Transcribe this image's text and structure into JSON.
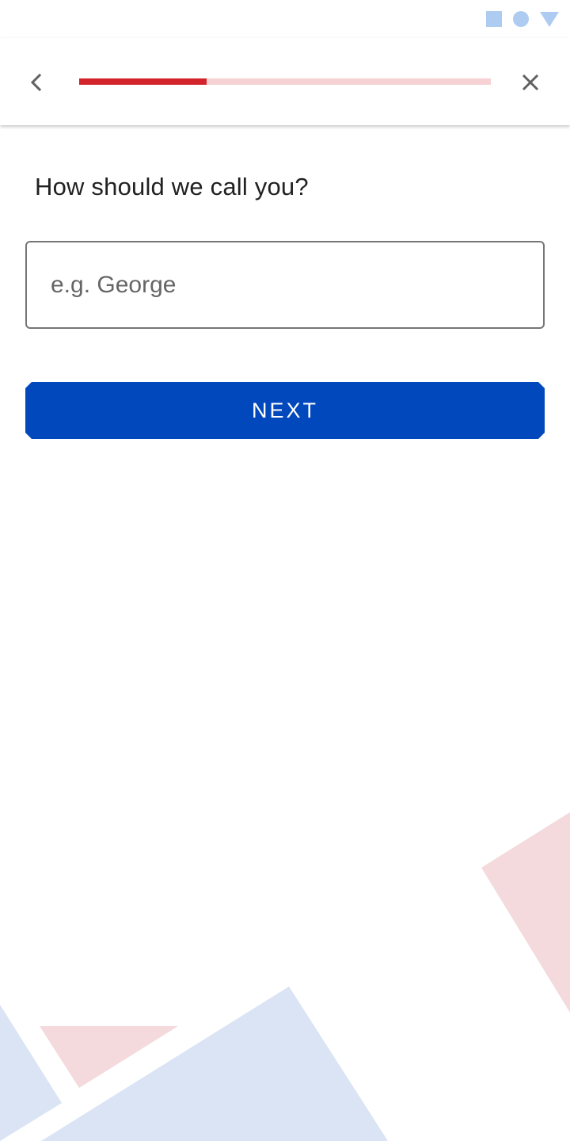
{
  "status_bar": {
    "icons": [
      "square-icon",
      "circle-icon",
      "triangle-icon"
    ],
    "color": "#aecbf1"
  },
  "toolbar": {
    "back_icon": "chevron-left-icon",
    "close_icon": "close-icon",
    "progress_fraction": 0.31,
    "progress_color": "#d3242b",
    "progress_track_color": "#f6d2d4"
  },
  "form": {
    "question": "How should we call you?",
    "name_input": {
      "value": "",
      "placeholder": "e.g. George"
    },
    "next_label": "NEXT",
    "button_color": "#0148bd"
  },
  "decor": {
    "blue": "#dae4f4",
    "pink": "#f4dadd"
  }
}
